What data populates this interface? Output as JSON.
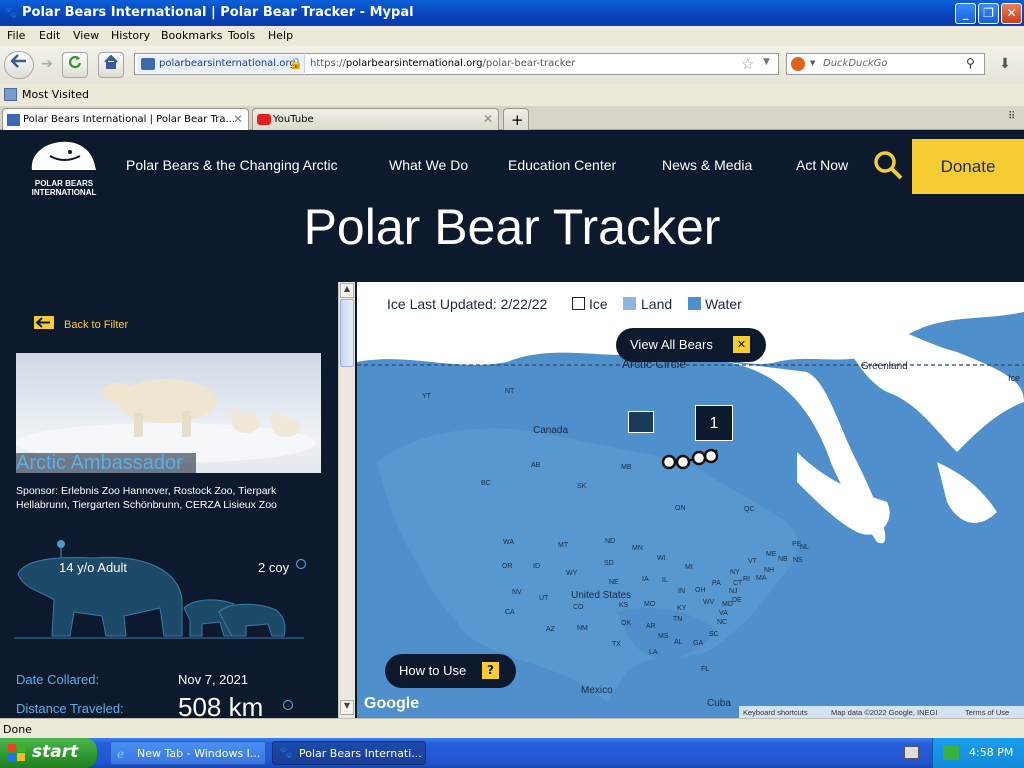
{
  "window": {
    "title": "Polar Bears International | Polar Bear Tracker - Mypal"
  },
  "menu": [
    "File",
    "Edit",
    "View",
    "History",
    "Bookmarks",
    "Tools",
    "Help"
  ],
  "urlbar": {
    "site": "polarbearsinternational.org",
    "url_prefix": "https://",
    "url_host": "polarbearsinternational.org",
    "url_path": "/polar-bear-tracker"
  },
  "search": {
    "placeholder": "DuckDuckGo"
  },
  "bookmarks": {
    "most_visited": "Most Visited"
  },
  "tabs": [
    {
      "label": "Polar Bears International | Polar Bear Tra..."
    },
    {
      "label": "YouTube"
    }
  ],
  "site": {
    "logo_line1": "POLAR BEARS",
    "logo_line2": "INTERNATIONAL",
    "nav": [
      "Polar Bears & the Changing Arctic",
      "What We Do",
      "Education Center",
      "News & Media",
      "Act Now"
    ],
    "donate": "Donate",
    "page_title": "Polar Bear Tracker"
  },
  "sidebar": {
    "back": "Back to Filter",
    "bear_name": "Arctic Ambassador",
    "sponsor": "Sponsor: Erlebnis Zoo Hannover, Rostock Zoo, Tierpark Hellabrunn, Tiergarten Schönbrunn, CERZA Lisieux Zoo",
    "age": "14 y/o Adult",
    "cubs": "2 coy",
    "date_label": "Date Collared:",
    "date_value": "Nov 7, 2021",
    "distance_label": "Distance Traveled:",
    "distance_value": "508 km"
  },
  "map": {
    "ice_updated": "Ice Last Updated: 2/22/22",
    "legend": {
      "ice": "Ice",
      "land": "Land",
      "water": "Water"
    },
    "view_all": "View All Bears",
    "how_to_use": "How to Use",
    "help_char": "?",
    "close_char": "✕",
    "arctic_circle": "Arctic Circle",
    "marker_count": "1",
    "google": "Google",
    "attrib_shortcuts": "Keyboard shortcuts",
    "attrib_data": "Map data ©2022 Google, INEGI",
    "attrib_terms": "Terms of Use",
    "labels": {
      "greenland": "Greenland",
      "canada": "Canada",
      "us": "United States",
      "mexico": "Mexico",
      "cuba": "Cuba",
      "ice": "Ice",
      "nt": "NT",
      "yt": "YT",
      "ab": "AB",
      "bc": "BC",
      "sk": "SK",
      "mb": "MB",
      "on": "ON",
      "qc": "QC",
      "nl": "NL",
      "ns": "NS",
      "nb": "NB",
      "pe": "PE",
      "wa": "WA",
      "or": "OR",
      "id": "ID",
      "mt": "MT",
      "nd": "ND",
      "mn": "MN",
      "wi": "WI",
      "mi": "MI",
      "ny": "NY",
      "me": "ME",
      "vt": "VT",
      "nh": "NH",
      "ma": "MA",
      "ri": "RI",
      "ct": "CT",
      "wy": "WY",
      "sd": "SD",
      "ia": "IA",
      "il": "IL",
      "in": "IN",
      "oh": "OH",
      "pa": "PA",
      "nj": "NJ",
      "de": "DE",
      "md": "MD",
      "nv": "NV",
      "ut": "UT",
      "co": "CO",
      "ne": "NE",
      "ks": "KS",
      "mo": "MO",
      "ky": "KY",
      "wv": "WV",
      "va": "VA",
      "ca": "CA",
      "az": "AZ",
      "nm": "NM",
      "ok": "OK",
      "ar": "AR",
      "tn": "TN",
      "nc": "NC",
      "sc": "SC",
      "ms": "MS",
      "al": "AL",
      "ga": "GA",
      "tx": "TX",
      "la": "LA",
      "fl": "FL"
    }
  },
  "status": "Done",
  "taskbar": {
    "start": "start",
    "tasks": [
      "New Tab - Windows I...",
      "Polar Bears Internati..."
    ],
    "clock": "4:58 PM"
  }
}
